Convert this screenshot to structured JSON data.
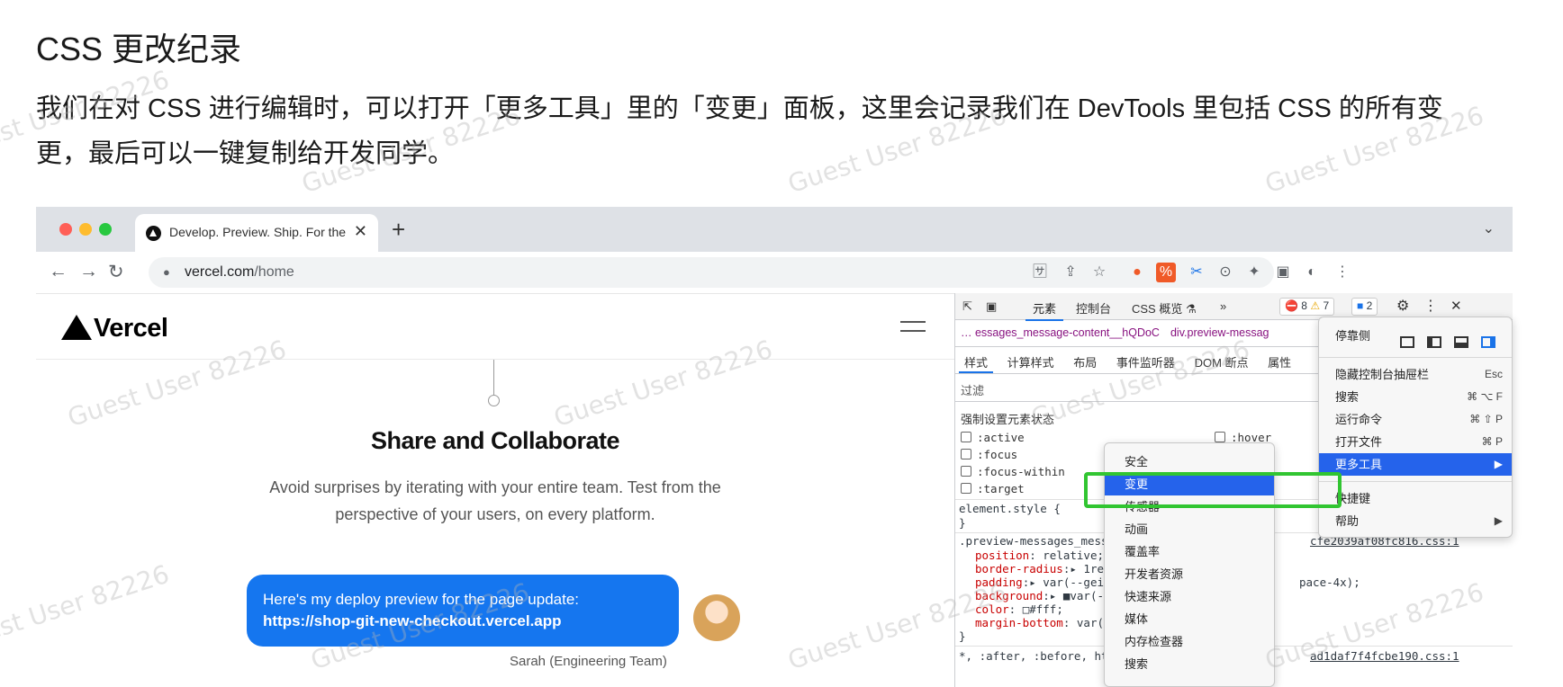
{
  "article": {
    "title": "CSS 更改纪录",
    "paragraph": "我们在对 CSS 进行编辑时，可以打开「更多工具」里的「变更」面板，这里会记录我们在 DevTools 里包括 CSS 的所有变更，最后可以一键复制给开发同学。"
  },
  "watermark": "Guest User 82226",
  "browser": {
    "tab_title": "Develop. Preview. Ship. For the",
    "tab_close": "✕",
    "new_tab": "+",
    "tab_list": "⌄",
    "url_host": "vercel.com",
    "url_path": "/home",
    "nav": {
      "back": "←",
      "forward": "→",
      "reload": "↻",
      "lock": "🔒"
    },
    "toolbar_icons": [
      "🈂",
      "⇪",
      "☆",
      "●",
      "%",
      "✂",
      "⊙",
      "✦",
      "▣",
      "◐",
      "⋮"
    ]
  },
  "page": {
    "logo": "Vercel",
    "heading": "Share and Collaborate",
    "subtext": "Avoid surprises by iterating with your entire team. Test from the perspective of your users, on every platform.",
    "bubble_text": "Here's my deploy preview for the page update:",
    "bubble_link": "https://shop-git-new-checkout.vercel.app",
    "sender": "Sarah (Engineering Team)"
  },
  "devtools": {
    "tabs": [
      "元素",
      "控制台",
      "CSS 概览 ⚗",
      "»"
    ],
    "errors": "8",
    "warnings": "7",
    "messages": "2",
    "breadcrumb_1": "… essages_message-content__hQDoC",
    "breadcrumb_2": "div.preview-messag",
    "subtabs": [
      "样式",
      "计算样式",
      "布局",
      "事件监听器",
      "DOM 断点",
      "属性"
    ],
    "filter": "过滤",
    "force_state_title": "强制设置元素状态",
    "states": [
      ":active",
      ":focus",
      ":focus-within",
      ":target"
    ],
    "state_hover": ":hover",
    "element_style": "element.style {",
    "close_brace": "}",
    "rule_selector": ".preview-messages_message",
    "rule_file": "cfe2039af08fc816.css:1",
    "rule_lines": [
      {
        "prop": "position",
        "value": " relative;"
      },
      {
        "prop": "border-radius",
        "value": "▸ 1rem;"
      },
      {
        "prop": "padding",
        "value": "▸ var(--geist-"
      },
      {
        "prop": "background",
        "value": "▸ ■var(--g"
      },
      {
        "prop": "color",
        "value": " □#fff;"
      },
      {
        "prop": "margin-bottom",
        "value": " var(--g"
      }
    ],
    "padding_tail": "pace-4x);",
    "universal_selector": "*, :after, :before, html",
    "universal_file": "ad1daf7f4fcbe190.css:1"
  },
  "more_tools_menu": {
    "items": [
      "安全",
      "变更",
      "传感器",
      "动画",
      "覆盖率",
      "开发者资源",
      "快速来源",
      "媒体",
      "内存检查器",
      "搜索"
    ],
    "highlighted": "变更"
  },
  "main_menu": {
    "dock_label": "停靠侧",
    "rows": [
      {
        "label": "隐藏控制台抽屉栏",
        "shortcut": "Esc"
      },
      {
        "label": "搜索",
        "shortcut": "⌘ ⌥ F"
      },
      {
        "label": "运行命令",
        "shortcut": "⌘ ⇧ P"
      },
      {
        "label": "打开文件",
        "shortcut": "⌘ P"
      },
      {
        "label": "更多工具",
        "shortcut": "▶"
      }
    ],
    "shortcuts_label": "快捷键",
    "help_label": "帮助",
    "help_arrow": "▶"
  },
  "colors": {
    "accent": "#1a73e8",
    "highlight": "#2563eb",
    "callout": "#31c531",
    "bubble": "#1576ef"
  }
}
